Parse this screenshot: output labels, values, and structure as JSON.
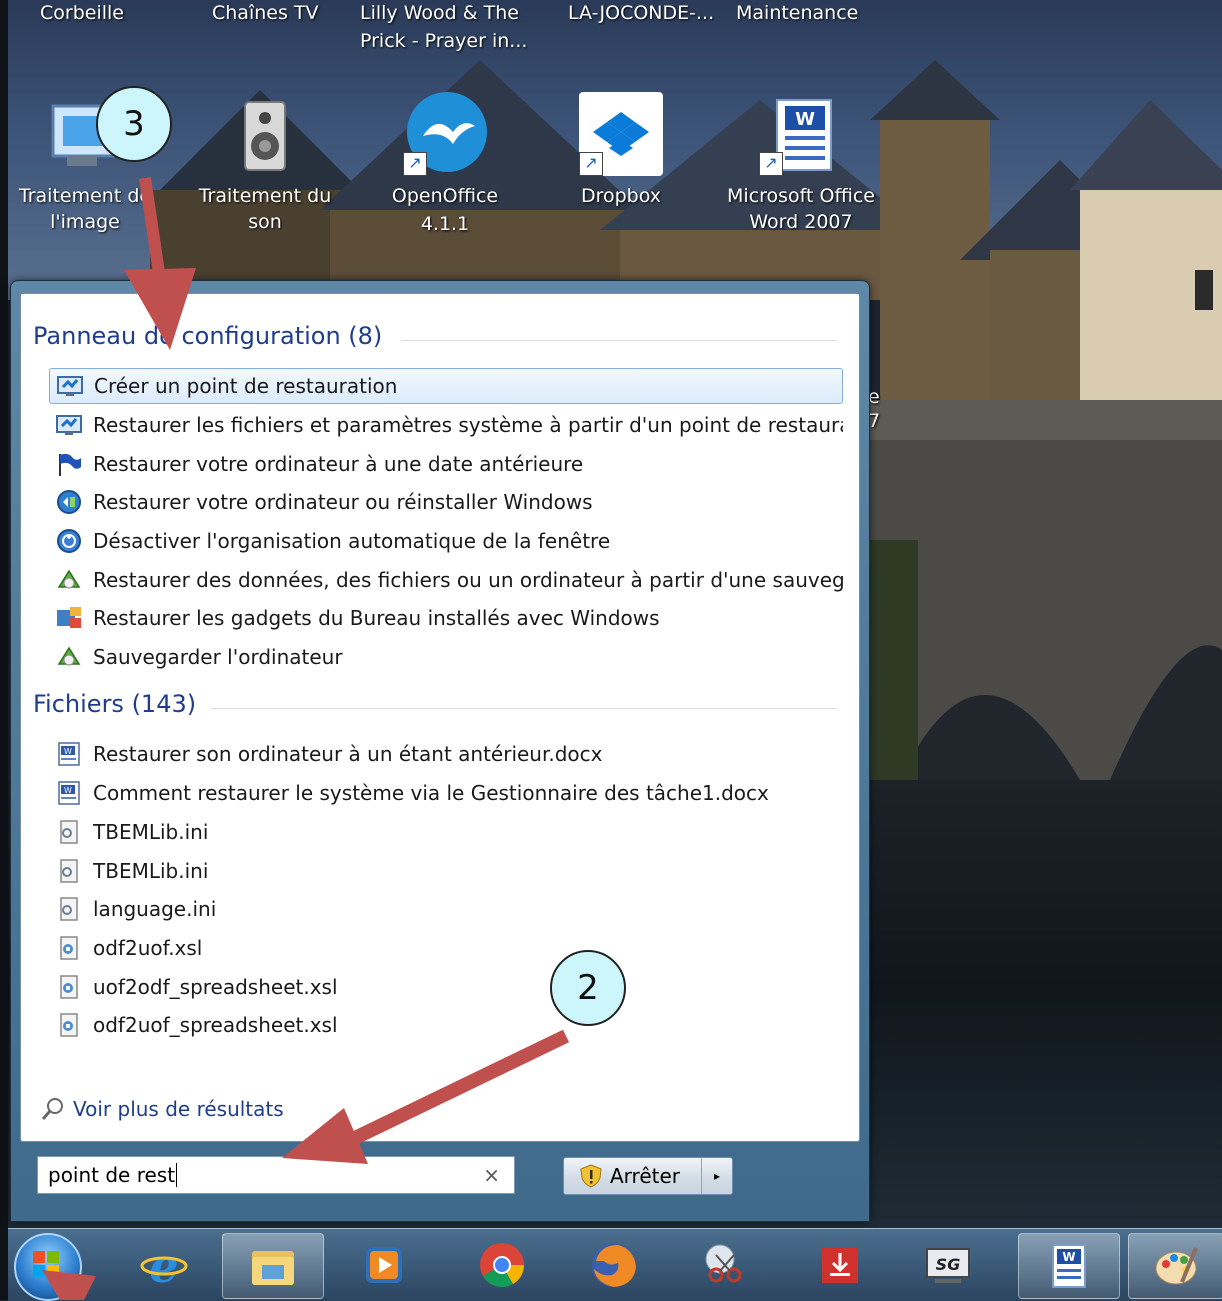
{
  "desktop": {
    "top_labels": [
      "Corbeille",
      "Chaînes TV",
      "Lilly Wood & The",
      "Prick - Prayer in...",
      "LA-JOCONDE-...",
      "Maintenance"
    ],
    "icons": [
      {
        "line1": "Traitement de",
        "line2": "l'image",
        "icon": "image-editing-icon"
      },
      {
        "line1": "Traitement du",
        "line2": "son",
        "icon": "speaker-icon"
      },
      {
        "line1": "OpenOffice 4.1.1",
        "line2": "",
        "icon": "openoffice-icon"
      },
      {
        "line1": "Dropbox",
        "line2": "",
        "icon": "dropbox-icon"
      },
      {
        "line1": "Microsoft Office",
        "line2": "Word 2007",
        "icon": "word-icon"
      }
    ],
    "partial_text": [
      "e",
      "7"
    ]
  },
  "start_menu": {
    "control_panel": {
      "title": "Panneau de configuration (8)",
      "items": [
        "Créer un point de restauration",
        "Restaurer les fichiers et paramètres système à partir d'un point de restaurati...",
        "Restaurer votre ordinateur à une date antérieure",
        "Restaurer votre ordinateur ou réinstaller Windows",
        "Désactiver l'organisation automatique de la fenêtre",
        "Restaurer des données, des fichiers ou un ordinateur à partir d'une sauvega...",
        "Restaurer les gadgets du Bureau installés avec Windows",
        "Sauvegarder l'ordinateur"
      ]
    },
    "files": {
      "title": "Fichiers (143)",
      "items": [
        "Restaurer son ordinateur à un étant antérieur.docx",
        "Comment restaurer le système via le Gestionnaire des tâche1.docx",
        "TBEMLib.ini",
        "TBEMLib.ini",
        "language.ini",
        "odf2uof.xsl",
        "uof2odf_spreadsheet.xsl",
        "odf2uof_spreadsheet.xsl"
      ]
    },
    "see_more": "Voir plus de résultats",
    "search": {
      "value": "point de rest",
      "clear": "×"
    },
    "shutdown": {
      "label": "Arrêter",
      "arrow": "▸"
    }
  },
  "annotations": {
    "bubble_top": "3",
    "bubble_bottom": "2",
    "color": "#c0504d"
  }
}
